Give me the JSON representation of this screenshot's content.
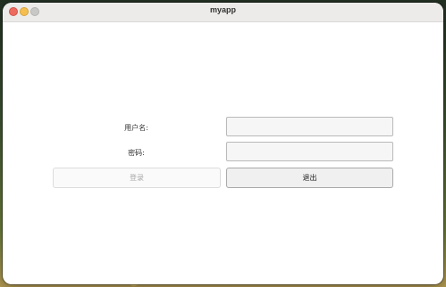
{
  "window": {
    "title": "myapp"
  },
  "form": {
    "username_label": "用户名:",
    "username_value": "",
    "password_label": "密码:",
    "password_value": ""
  },
  "buttons": {
    "login_label": "登录",
    "login_disabled": true,
    "quit_label": "退出"
  }
}
